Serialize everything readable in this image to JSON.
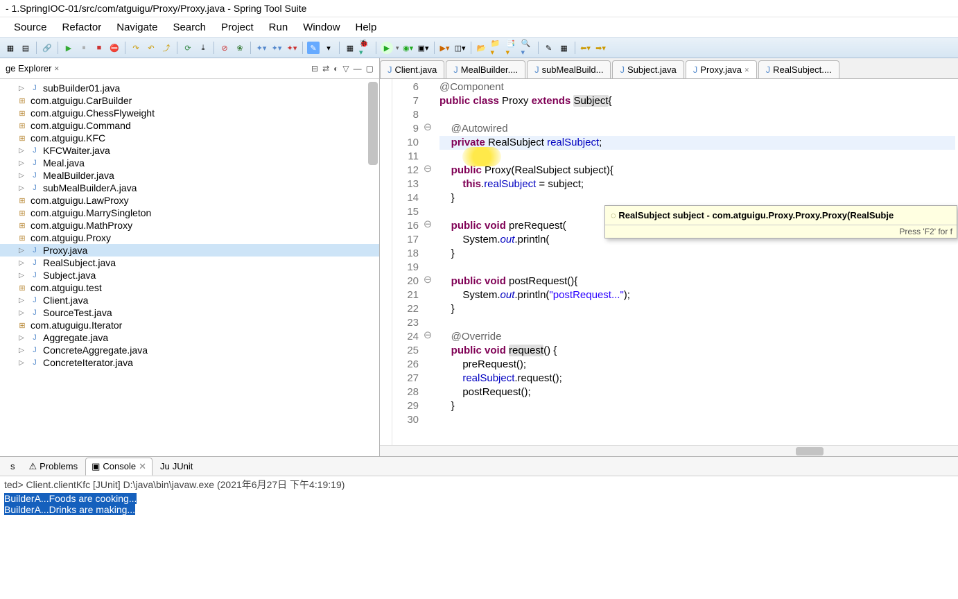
{
  "title": "- 1.SpringIOC-01/src/com/atguigu/Proxy/Proxy.java - Spring Tool Suite",
  "menu": [
    "Source",
    "Refactor",
    "Navigate",
    "Search",
    "Project",
    "Run",
    "Window",
    "Help"
  ],
  "explorer": {
    "title": "ge Explorer",
    "items": [
      {
        "indent": 1,
        "arrow": "▷",
        "icon": "j",
        "label": "subBuilder01.java"
      },
      {
        "indent": 0,
        "arrow": "",
        "icon": "pkg",
        "label": "com.atguigu.CarBuilder"
      },
      {
        "indent": 0,
        "arrow": "",
        "icon": "pkg",
        "label": "com.atguigu.ChessFlyweight"
      },
      {
        "indent": 0,
        "arrow": "",
        "icon": "pkg",
        "label": "com.atguigu.Command"
      },
      {
        "indent": 0,
        "arrow": "",
        "icon": "pkg",
        "label": "com.atguigu.KFC"
      },
      {
        "indent": 1,
        "arrow": "▷",
        "icon": "j",
        "label": "KFCWaiter.java"
      },
      {
        "indent": 1,
        "arrow": "▷",
        "icon": "j",
        "label": "Meal.java"
      },
      {
        "indent": 1,
        "arrow": "▷",
        "icon": "j",
        "label": "MealBuilder.java"
      },
      {
        "indent": 1,
        "arrow": "▷",
        "icon": "j",
        "label": "subMealBuilderA.java"
      },
      {
        "indent": 0,
        "arrow": "",
        "icon": "pkg",
        "label": "com.atguigu.LawProxy"
      },
      {
        "indent": 0,
        "arrow": "",
        "icon": "pkg",
        "label": "com.atguigu.MarrySingleton"
      },
      {
        "indent": 0,
        "arrow": "",
        "icon": "pkg",
        "label": "com.atguigu.MathProxy"
      },
      {
        "indent": 0,
        "arrow": "",
        "icon": "pkg",
        "label": "com.atguigu.Proxy"
      },
      {
        "indent": 1,
        "arrow": "▷",
        "icon": "j",
        "label": "Proxy.java",
        "sel": true
      },
      {
        "indent": 1,
        "arrow": "▷",
        "icon": "j",
        "label": "RealSubject.java"
      },
      {
        "indent": 1,
        "arrow": "▷",
        "icon": "j",
        "label": "Subject.java"
      },
      {
        "indent": 0,
        "arrow": "",
        "icon": "pkg",
        "label": "com.atguigu.test"
      },
      {
        "indent": 1,
        "arrow": "▷",
        "icon": "j",
        "label": "Client.java"
      },
      {
        "indent": 1,
        "arrow": "▷",
        "icon": "j",
        "label": "SourceTest.java"
      },
      {
        "indent": 0,
        "arrow": "",
        "icon": "pkg",
        "label": "com.atuguigu.Iterator"
      },
      {
        "indent": 1,
        "arrow": "▷",
        "icon": "j",
        "label": "Aggregate.java"
      },
      {
        "indent": 1,
        "arrow": "▷",
        "icon": "j",
        "label": "ConcreteAggregate.java"
      },
      {
        "indent": 1,
        "arrow": "▷",
        "icon": "j",
        "label": "ConcreteIterator.java"
      }
    ]
  },
  "tabs": [
    {
      "label": "Client.java"
    },
    {
      "label": "MealBuilder...."
    },
    {
      "label": "subMealBuild..."
    },
    {
      "label": "Subject.java"
    },
    {
      "label": "Proxy.java",
      "active": true,
      "close": true
    },
    {
      "label": "RealSubject...."
    }
  ],
  "code": {
    "start": 6,
    "lines": [
      {
        "n": 6,
        "fold": "",
        "html": "<span class='ann'>@Component</span>"
      },
      {
        "n": 7,
        "fold": "",
        "html": "<span class='kw'>public</span> <span class='kw'>class</span> Proxy <span class='kw'>extends</span> <span class='hl-occ'>Subject</span>{"
      },
      {
        "n": 8,
        "fold": "",
        "html": ""
      },
      {
        "n": 9,
        "fold": "⊖",
        "html": "    <span class='ann'>@Autowired</span>"
      },
      {
        "n": 10,
        "fold": "",
        "hl": true,
        "html": "    <span class='kw'>private</span> RealSubject <span class='fld'>realSubject</span>;"
      },
      {
        "n": 11,
        "fold": "",
        "html": ""
      },
      {
        "n": 12,
        "fold": "⊖",
        "html": "    <span class='kw'>public</span> Proxy(RealSubject subject){"
      },
      {
        "n": 13,
        "fold": "",
        "html": "        <span class='kw'>this</span>.<span class='fld'>realSubject</span> = subject;"
      },
      {
        "n": 14,
        "fold": "",
        "html": "    }"
      },
      {
        "n": 15,
        "fold": "",
        "html": ""
      },
      {
        "n": 16,
        "fold": "⊖",
        "html": "    <span class='kw'>public</span> <span class='kw'>void</span> preRequest("
      },
      {
        "n": 17,
        "fold": "",
        "html": "        System.<span class='fld-static'>out</span>.println("
      },
      {
        "n": 18,
        "fold": "",
        "html": "    }"
      },
      {
        "n": 19,
        "fold": "",
        "html": ""
      },
      {
        "n": 20,
        "fold": "⊖",
        "html": "    <span class='kw'>public</span> <span class='kw'>void</span> postRequest(){"
      },
      {
        "n": 21,
        "fold": "",
        "html": "        System.<span class='fld-static'>out</span>.println(<span class='str'>\"postRequest...\"</span>);"
      },
      {
        "n": 22,
        "fold": "",
        "html": "    }"
      },
      {
        "n": 23,
        "fold": "",
        "html": ""
      },
      {
        "n": 24,
        "fold": "⊖",
        "html": "    <span class='ann'>@Override</span>"
      },
      {
        "n": 25,
        "fold": "",
        "html": "    <span class='kw'>public</span> <span class='kw'>void</span> <span class='hl-occ'>request</span>() {"
      },
      {
        "n": 26,
        "fold": "",
        "html": "        preRequest();"
      },
      {
        "n": 27,
        "fold": "",
        "html": "        <span class='fld'>realSubject</span>.request();"
      },
      {
        "n": 28,
        "fold": "",
        "html": "        postRequest();"
      },
      {
        "n": 29,
        "fold": "",
        "html": "    }"
      },
      {
        "n": 30,
        "fold": "",
        "html": ""
      }
    ]
  },
  "tooltip": {
    "sig": "RealSubject subject - com.atguigu.Proxy.Proxy.Proxy(RealSubje",
    "foot": "Press 'F2' for f"
  },
  "bottomTabs": [
    {
      "label": "s",
      "icon": ""
    },
    {
      "label": "Problems",
      "icon": "⚠"
    },
    {
      "label": "Console",
      "icon": "▣",
      "active": true,
      "close": true
    },
    {
      "label": "JUnit",
      "icon": "Ju"
    }
  ],
  "console": {
    "hdr": "ted> Client.clientKfc [JUnit] D:\\java\\bin\\javaw.exe (2021年6月27日 下午4:19:19)",
    "out": [
      "BuilderA...Foods are cooking...",
      "BuilderA...Drinks are making..."
    ]
  }
}
